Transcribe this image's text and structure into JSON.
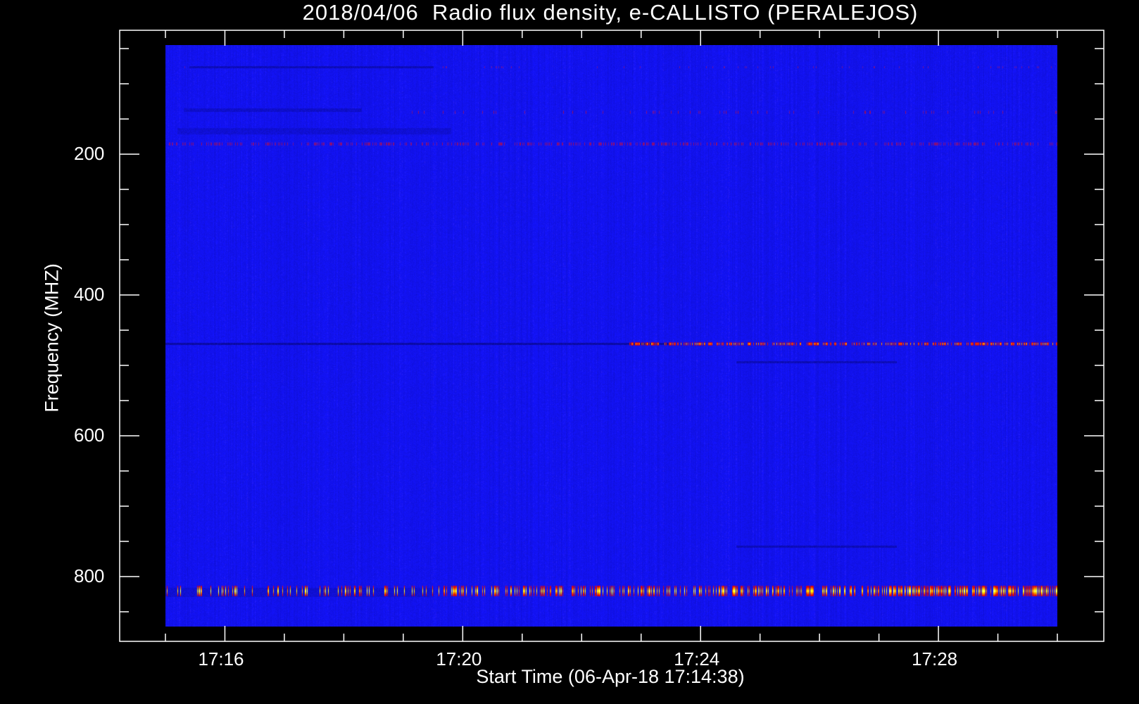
{
  "chart_data": {
    "type": "heatmap",
    "title": "2018/04/06  Radio flux density, e-CALLISTO (PERALEJOS)",
    "xlabel": "Start Time (06-Apr-18 17:14:38)",
    "ylabel": "Frequency (MHZ)",
    "x_unit": "minutes after 17:00 UT",
    "xlim": [
      14.23,
      30.78
    ],
    "data_xrange": [
      15,
      30
    ],
    "ylim": [
      45,
      915
    ],
    "data_yrange": [
      45,
      871
    ],
    "y_inverted": true,
    "x_major_ticks": [
      16,
      20,
      24,
      28
    ],
    "x_tick_labels": [
      "17:16",
      "17:20",
      "17:24",
      "17:28"
    ],
    "x_minor_step": 1,
    "y_major_ticks": [
      200,
      400,
      600,
      800
    ],
    "y_tick_labels": [
      "200",
      "400",
      "600",
      "800"
    ],
    "y_minor_step": 50,
    "colormap": [
      "#000000",
      "#0000ff",
      "#ff0000",
      "#ffff00",
      "#ffffff"
    ],
    "background_level": 0.5,
    "features": [
      {
        "type": "emission",
        "freq": 76,
        "width": 3,
        "start": 15,
        "end": 30,
        "level": 0.66,
        "prob": 0.06
      },
      {
        "type": "absorption",
        "freq": 76,
        "width": 3,
        "start": 15.4,
        "end": 19.5,
        "level": 0.3
      },
      {
        "type": "absorption",
        "freq": 137,
        "width": 4,
        "start": 15.3,
        "end": 18.3,
        "level": 0.35
      },
      {
        "type": "emission",
        "freq": 140,
        "width": 4,
        "start": 19,
        "end": 30,
        "level": 0.7,
        "prob": 0.06
      },
      {
        "type": "absorption",
        "freq": 167,
        "width": 8,
        "start": 15.2,
        "end": 19.8,
        "level": 0.38
      },
      {
        "type": "emission",
        "freq": 185,
        "width": 4,
        "start": 15,
        "end": 30,
        "level": 0.7,
        "prob": 0.3
      },
      {
        "type": "absorption",
        "freq": 469,
        "width": 3,
        "start": 15,
        "end": 23.5,
        "level": 0.25
      },
      {
        "type": "emission",
        "freq": 469,
        "width": 4,
        "start": 22.8,
        "end": 30,
        "level": 0.9,
        "prob": 0.45
      },
      {
        "type": "absorption",
        "freq": 495,
        "width": 3,
        "start": 24.6,
        "end": 27.3,
        "level": 0.3
      },
      {
        "type": "absorption",
        "freq": 757,
        "width": 3,
        "start": 24.6,
        "end": 27.3,
        "level": 0.3
      },
      {
        "type": "absorption",
        "freq": 822,
        "width": 12,
        "start": 15,
        "end": 19.5,
        "level": 0.38
      },
      {
        "type": "emission",
        "freq": 820,
        "width": 14,
        "start": 15,
        "end": 30,
        "level": 0.98,
        "prob": 0.5,
        "ramp": true
      }
    ]
  }
}
